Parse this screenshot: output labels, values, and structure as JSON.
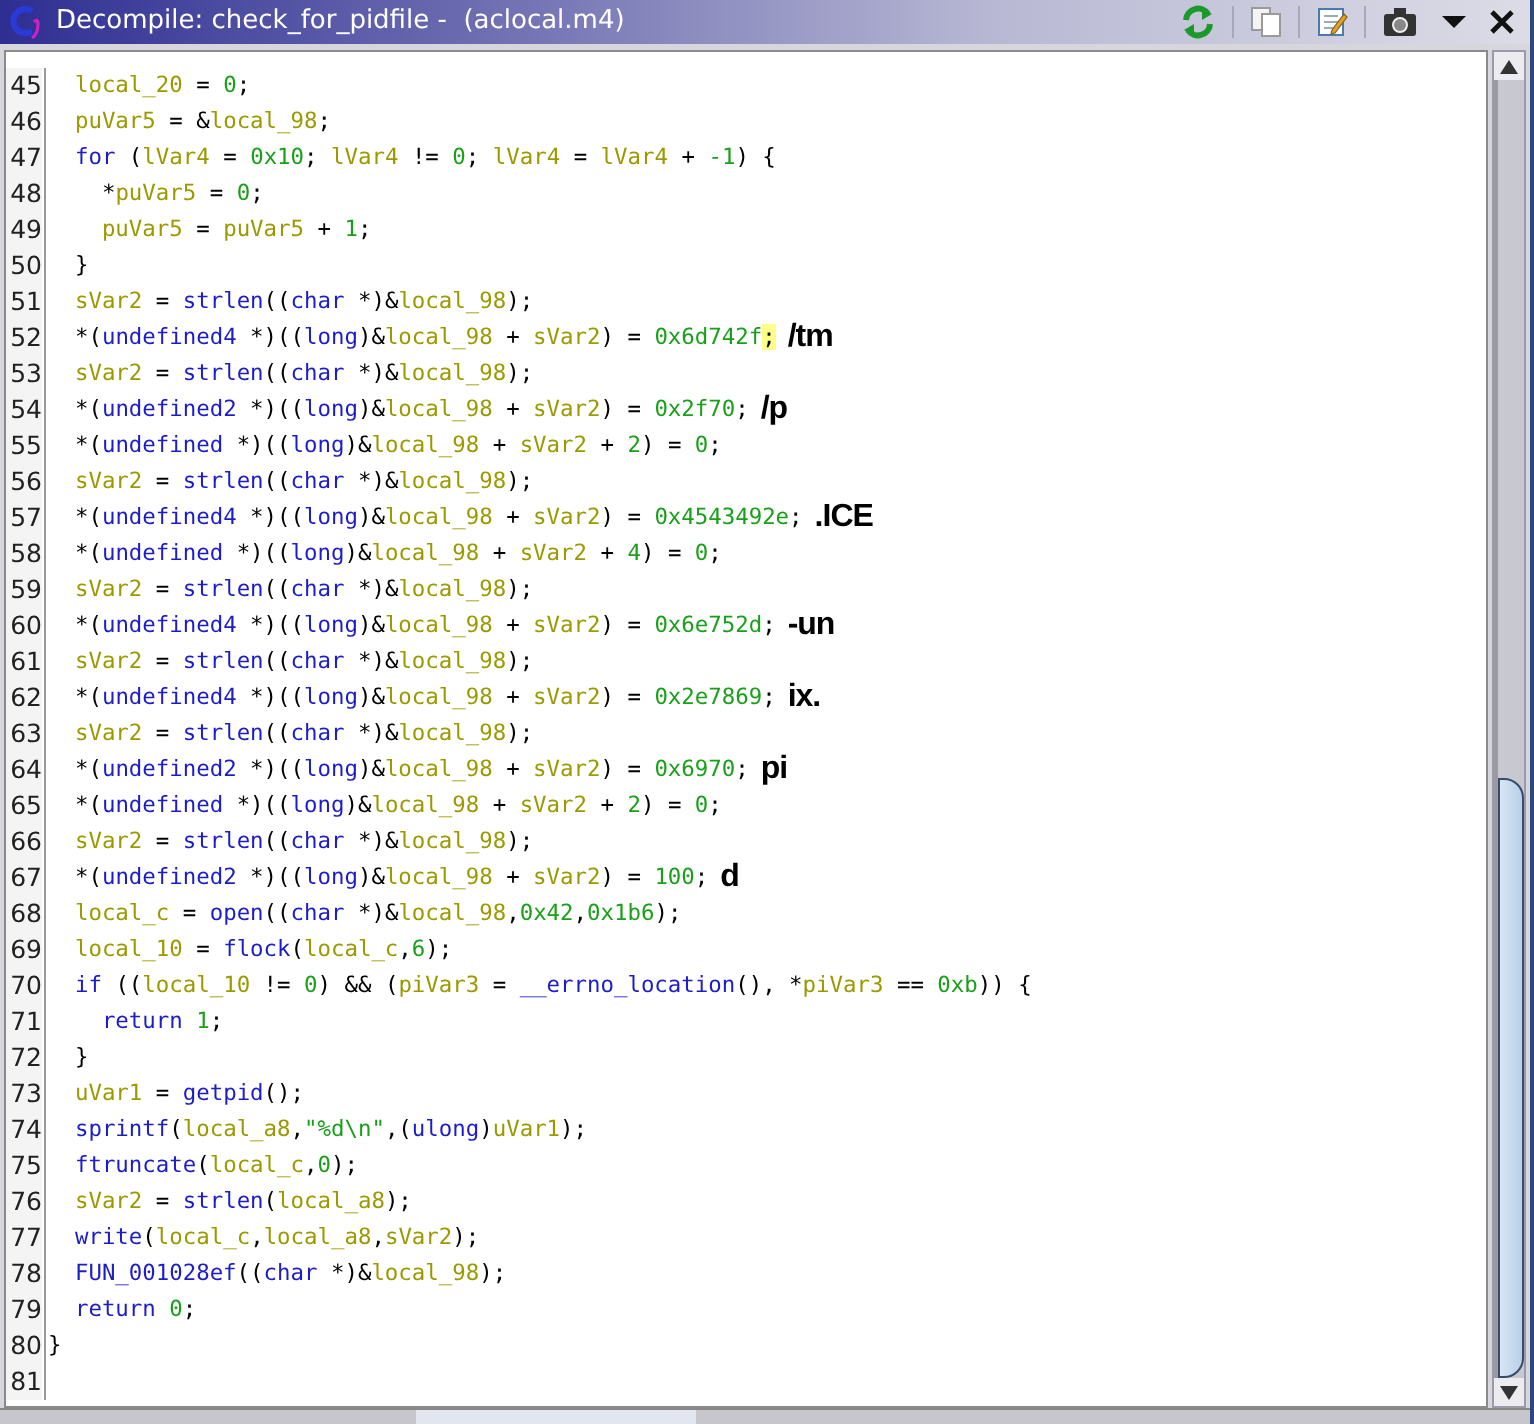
{
  "window": {
    "title": "Decompile: check_for_pidfile -  (aclocal.m4)"
  },
  "code_lines": [
    {
      "number": "45",
      "tokens": [
        {
          "kind": "var",
          "text": "  local_20"
        },
        {
          "kind": "plain",
          "text": " = "
        },
        {
          "kind": "num",
          "text": "0"
        },
        {
          "kind": "plain",
          "text": ";"
        }
      ]
    },
    {
      "number": "46",
      "tokens": [
        {
          "kind": "var",
          "text": "  puVar5"
        },
        {
          "kind": "plain",
          "text": " = &"
        },
        {
          "kind": "var",
          "text": "local_98"
        },
        {
          "kind": "plain",
          "text": ";"
        }
      ]
    },
    {
      "number": "47",
      "tokens": [
        {
          "kind": "kw",
          "text": "  for"
        },
        {
          "kind": "plain",
          "text": " ("
        },
        {
          "kind": "var",
          "text": "lVar4"
        },
        {
          "kind": "plain",
          "text": " = "
        },
        {
          "kind": "num",
          "text": "0x10"
        },
        {
          "kind": "plain",
          "text": "; "
        },
        {
          "kind": "var",
          "text": "lVar4"
        },
        {
          "kind": "plain",
          "text": " != "
        },
        {
          "kind": "num",
          "text": "0"
        },
        {
          "kind": "plain",
          "text": "; "
        },
        {
          "kind": "var",
          "text": "lVar4"
        },
        {
          "kind": "plain",
          "text": " = "
        },
        {
          "kind": "var",
          "text": "lVar4"
        },
        {
          "kind": "plain",
          "text": " + "
        },
        {
          "kind": "num",
          "text": "-1"
        },
        {
          "kind": "plain",
          "text": ") {"
        }
      ]
    },
    {
      "number": "48",
      "tokens": [
        {
          "kind": "plain",
          "text": "    *"
        },
        {
          "kind": "var",
          "text": "puVar5"
        },
        {
          "kind": "plain",
          "text": " = "
        },
        {
          "kind": "num",
          "text": "0"
        },
        {
          "kind": "plain",
          "text": ";"
        }
      ]
    },
    {
      "number": "49",
      "tokens": [
        {
          "kind": "var",
          "text": "    puVar5"
        },
        {
          "kind": "plain",
          "text": " = "
        },
        {
          "kind": "var",
          "text": "puVar5"
        },
        {
          "kind": "plain",
          "text": " + "
        },
        {
          "kind": "num",
          "text": "1"
        },
        {
          "kind": "plain",
          "text": ";"
        }
      ]
    },
    {
      "number": "50",
      "tokens": [
        {
          "kind": "plain",
          "text": "  }"
        }
      ]
    },
    {
      "number": "51",
      "tokens": [
        {
          "kind": "var",
          "text": "  sVar2"
        },
        {
          "kind": "plain",
          "text": " = "
        },
        {
          "kind": "fn",
          "text": "strlen"
        },
        {
          "kind": "plain",
          "text": "(("
        },
        {
          "kind": "kw",
          "text": "char"
        },
        {
          "kind": "plain",
          "text": " *)&"
        },
        {
          "kind": "var",
          "text": "local_98"
        },
        {
          "kind": "plain",
          "text": ");"
        }
      ]
    },
    {
      "number": "52",
      "annotation": "/tm",
      "tokens": [
        {
          "kind": "plain",
          "text": "  *("
        },
        {
          "kind": "kw",
          "text": "undefined4"
        },
        {
          "kind": "plain",
          "text": " *)(("
        },
        {
          "kind": "kw",
          "text": "long"
        },
        {
          "kind": "plain",
          "text": ")&"
        },
        {
          "kind": "var",
          "text": "local_98"
        },
        {
          "kind": "plain",
          "text": " + "
        },
        {
          "kind": "var",
          "text": "sVar2"
        },
        {
          "kind": "plain",
          "text": ") = "
        },
        {
          "kind": "num",
          "text": "0x6d742f"
        },
        {
          "kind": "highlight",
          "text": ";"
        }
      ]
    },
    {
      "number": "53",
      "tokens": [
        {
          "kind": "var",
          "text": "  sVar2"
        },
        {
          "kind": "plain",
          "text": " = "
        },
        {
          "kind": "fn",
          "text": "strlen"
        },
        {
          "kind": "plain",
          "text": "(("
        },
        {
          "kind": "kw",
          "text": "char"
        },
        {
          "kind": "plain",
          "text": " *)&"
        },
        {
          "kind": "var",
          "text": "local_98"
        },
        {
          "kind": "plain",
          "text": ");"
        }
      ]
    },
    {
      "number": "54",
      "annotation": "/p",
      "tokens": [
        {
          "kind": "plain",
          "text": "  *("
        },
        {
          "kind": "kw",
          "text": "undefined2"
        },
        {
          "kind": "plain",
          "text": " *)(("
        },
        {
          "kind": "kw",
          "text": "long"
        },
        {
          "kind": "plain",
          "text": ")&"
        },
        {
          "kind": "var",
          "text": "local_98"
        },
        {
          "kind": "plain",
          "text": " + "
        },
        {
          "kind": "var",
          "text": "sVar2"
        },
        {
          "kind": "plain",
          "text": ") = "
        },
        {
          "kind": "num",
          "text": "0x2f70"
        },
        {
          "kind": "plain",
          "text": ";"
        }
      ]
    },
    {
      "number": "55",
      "tokens": [
        {
          "kind": "plain",
          "text": "  *("
        },
        {
          "kind": "kw",
          "text": "undefined"
        },
        {
          "kind": "plain",
          "text": " *)(("
        },
        {
          "kind": "kw",
          "text": "long"
        },
        {
          "kind": "plain",
          "text": ")&"
        },
        {
          "kind": "var",
          "text": "local_98"
        },
        {
          "kind": "plain",
          "text": " + "
        },
        {
          "kind": "var",
          "text": "sVar2"
        },
        {
          "kind": "plain",
          "text": " + "
        },
        {
          "kind": "num",
          "text": "2"
        },
        {
          "kind": "plain",
          "text": ") = "
        },
        {
          "kind": "num",
          "text": "0"
        },
        {
          "kind": "plain",
          "text": ";"
        }
      ]
    },
    {
      "number": "56",
      "tokens": [
        {
          "kind": "var",
          "text": "  sVar2"
        },
        {
          "kind": "plain",
          "text": " = "
        },
        {
          "kind": "fn",
          "text": "strlen"
        },
        {
          "kind": "plain",
          "text": "(("
        },
        {
          "kind": "kw",
          "text": "char"
        },
        {
          "kind": "plain",
          "text": " *)&"
        },
        {
          "kind": "var",
          "text": "local_98"
        },
        {
          "kind": "plain",
          "text": ");"
        }
      ]
    },
    {
      "number": "57",
      "annotation": ".ICE",
      "tokens": [
        {
          "kind": "plain",
          "text": "  *("
        },
        {
          "kind": "kw",
          "text": "undefined4"
        },
        {
          "kind": "plain",
          "text": " *)(("
        },
        {
          "kind": "kw",
          "text": "long"
        },
        {
          "kind": "plain",
          "text": ")&"
        },
        {
          "kind": "var",
          "text": "local_98"
        },
        {
          "kind": "plain",
          "text": " + "
        },
        {
          "kind": "var",
          "text": "sVar2"
        },
        {
          "kind": "plain",
          "text": ") = "
        },
        {
          "kind": "num",
          "text": "0x4543492e"
        },
        {
          "kind": "plain",
          "text": ";"
        }
      ]
    },
    {
      "number": "58",
      "tokens": [
        {
          "kind": "plain",
          "text": "  *("
        },
        {
          "kind": "kw",
          "text": "undefined"
        },
        {
          "kind": "plain",
          "text": " *)(("
        },
        {
          "kind": "kw",
          "text": "long"
        },
        {
          "kind": "plain",
          "text": ")&"
        },
        {
          "kind": "var",
          "text": "local_98"
        },
        {
          "kind": "plain",
          "text": " + "
        },
        {
          "kind": "var",
          "text": "sVar2"
        },
        {
          "kind": "plain",
          "text": " + "
        },
        {
          "kind": "num",
          "text": "4"
        },
        {
          "kind": "plain",
          "text": ") = "
        },
        {
          "kind": "num",
          "text": "0"
        },
        {
          "kind": "plain",
          "text": ";"
        }
      ]
    },
    {
      "number": "59",
      "tokens": [
        {
          "kind": "var",
          "text": "  sVar2"
        },
        {
          "kind": "plain",
          "text": " = "
        },
        {
          "kind": "fn",
          "text": "strlen"
        },
        {
          "kind": "plain",
          "text": "(("
        },
        {
          "kind": "kw",
          "text": "char"
        },
        {
          "kind": "plain",
          "text": " *)&"
        },
        {
          "kind": "var",
          "text": "local_98"
        },
        {
          "kind": "plain",
          "text": ");"
        }
      ]
    },
    {
      "number": "60",
      "annotation": "-un",
      "tokens": [
        {
          "kind": "plain",
          "text": "  *("
        },
        {
          "kind": "kw",
          "text": "undefined4"
        },
        {
          "kind": "plain",
          "text": " *)(("
        },
        {
          "kind": "kw",
          "text": "long"
        },
        {
          "kind": "plain",
          "text": ")&"
        },
        {
          "kind": "var",
          "text": "local_98"
        },
        {
          "kind": "plain",
          "text": " + "
        },
        {
          "kind": "var",
          "text": "sVar2"
        },
        {
          "kind": "plain",
          "text": ") = "
        },
        {
          "kind": "num",
          "text": "0x6e752d"
        },
        {
          "kind": "plain",
          "text": ";"
        }
      ]
    },
    {
      "number": "61",
      "tokens": [
        {
          "kind": "var",
          "text": "  sVar2"
        },
        {
          "kind": "plain",
          "text": " = "
        },
        {
          "kind": "fn",
          "text": "strlen"
        },
        {
          "kind": "plain",
          "text": "(("
        },
        {
          "kind": "kw",
          "text": "char"
        },
        {
          "kind": "plain",
          "text": " *)&"
        },
        {
          "kind": "var",
          "text": "local_98"
        },
        {
          "kind": "plain",
          "text": ");"
        }
      ]
    },
    {
      "number": "62",
      "annotation": "ix.",
      "tokens": [
        {
          "kind": "plain",
          "text": "  *("
        },
        {
          "kind": "kw",
          "text": "undefined4"
        },
        {
          "kind": "plain",
          "text": " *)(("
        },
        {
          "kind": "kw",
          "text": "long"
        },
        {
          "kind": "plain",
          "text": ")&"
        },
        {
          "kind": "var",
          "text": "local_98"
        },
        {
          "kind": "plain",
          "text": " + "
        },
        {
          "kind": "var",
          "text": "sVar2"
        },
        {
          "kind": "plain",
          "text": ") = "
        },
        {
          "kind": "num",
          "text": "0x2e7869"
        },
        {
          "kind": "plain",
          "text": ";"
        }
      ]
    },
    {
      "number": "63",
      "tokens": [
        {
          "kind": "var",
          "text": "  sVar2"
        },
        {
          "kind": "plain",
          "text": " = "
        },
        {
          "kind": "fn",
          "text": "strlen"
        },
        {
          "kind": "plain",
          "text": "(("
        },
        {
          "kind": "kw",
          "text": "char"
        },
        {
          "kind": "plain",
          "text": " *)&"
        },
        {
          "kind": "var",
          "text": "local_98"
        },
        {
          "kind": "plain",
          "text": ");"
        }
      ]
    },
    {
      "number": "64",
      "annotation": "pi",
      "tokens": [
        {
          "kind": "plain",
          "text": "  *("
        },
        {
          "kind": "kw",
          "text": "undefined2"
        },
        {
          "kind": "plain",
          "text": " *)(("
        },
        {
          "kind": "kw",
          "text": "long"
        },
        {
          "kind": "plain",
          "text": ")&"
        },
        {
          "kind": "var",
          "text": "local_98"
        },
        {
          "kind": "plain",
          "text": " + "
        },
        {
          "kind": "var",
          "text": "sVar2"
        },
        {
          "kind": "plain",
          "text": ") = "
        },
        {
          "kind": "num",
          "text": "0x6970"
        },
        {
          "kind": "plain",
          "text": ";"
        }
      ]
    },
    {
      "number": "65",
      "tokens": [
        {
          "kind": "plain",
          "text": "  *("
        },
        {
          "kind": "kw",
          "text": "undefined"
        },
        {
          "kind": "plain",
          "text": " *)(("
        },
        {
          "kind": "kw",
          "text": "long"
        },
        {
          "kind": "plain",
          "text": ")&"
        },
        {
          "kind": "var",
          "text": "local_98"
        },
        {
          "kind": "plain",
          "text": " + "
        },
        {
          "kind": "var",
          "text": "sVar2"
        },
        {
          "kind": "plain",
          "text": " + "
        },
        {
          "kind": "num",
          "text": "2"
        },
        {
          "kind": "plain",
          "text": ") = "
        },
        {
          "kind": "num",
          "text": "0"
        },
        {
          "kind": "plain",
          "text": ";"
        }
      ]
    },
    {
      "number": "66",
      "tokens": [
        {
          "kind": "var",
          "text": "  sVar2"
        },
        {
          "kind": "plain",
          "text": " = "
        },
        {
          "kind": "fn",
          "text": "strlen"
        },
        {
          "kind": "plain",
          "text": "(("
        },
        {
          "kind": "kw",
          "text": "char"
        },
        {
          "kind": "plain",
          "text": " *)&"
        },
        {
          "kind": "var",
          "text": "local_98"
        },
        {
          "kind": "plain",
          "text": ");"
        }
      ]
    },
    {
      "number": "67",
      "annotation": "d",
      "tokens": [
        {
          "kind": "plain",
          "text": "  *("
        },
        {
          "kind": "kw",
          "text": "undefined2"
        },
        {
          "kind": "plain",
          "text": " *)(("
        },
        {
          "kind": "kw",
          "text": "long"
        },
        {
          "kind": "plain",
          "text": ")&"
        },
        {
          "kind": "var",
          "text": "local_98"
        },
        {
          "kind": "plain",
          "text": " + "
        },
        {
          "kind": "var",
          "text": "sVar2"
        },
        {
          "kind": "plain",
          "text": ") = "
        },
        {
          "kind": "num",
          "text": "100"
        },
        {
          "kind": "plain",
          "text": ";"
        }
      ]
    },
    {
      "number": "68",
      "tokens": [
        {
          "kind": "var",
          "text": "  local_c"
        },
        {
          "kind": "plain",
          "text": " = "
        },
        {
          "kind": "fn",
          "text": "open"
        },
        {
          "kind": "plain",
          "text": "(("
        },
        {
          "kind": "kw",
          "text": "char"
        },
        {
          "kind": "plain",
          "text": " *)&"
        },
        {
          "kind": "var",
          "text": "local_98"
        },
        {
          "kind": "plain",
          "text": ","
        },
        {
          "kind": "num",
          "text": "0x42"
        },
        {
          "kind": "plain",
          "text": ","
        },
        {
          "kind": "num",
          "text": "0x1b6"
        },
        {
          "kind": "plain",
          "text": ");"
        }
      ]
    },
    {
      "number": "69",
      "tokens": [
        {
          "kind": "var",
          "text": "  local_10"
        },
        {
          "kind": "plain",
          "text": " = "
        },
        {
          "kind": "fn",
          "text": "flock"
        },
        {
          "kind": "plain",
          "text": "("
        },
        {
          "kind": "var",
          "text": "local_c"
        },
        {
          "kind": "plain",
          "text": ","
        },
        {
          "kind": "num",
          "text": "6"
        },
        {
          "kind": "plain",
          "text": ");"
        }
      ]
    },
    {
      "number": "70",
      "tokens": [
        {
          "kind": "kw",
          "text": "  if"
        },
        {
          "kind": "plain",
          "text": " (("
        },
        {
          "kind": "var",
          "text": "local_10"
        },
        {
          "kind": "plain",
          "text": " != "
        },
        {
          "kind": "num",
          "text": "0"
        },
        {
          "kind": "plain",
          "text": ") && ("
        },
        {
          "kind": "var",
          "text": "piVar3"
        },
        {
          "kind": "plain",
          "text": " = "
        },
        {
          "kind": "fn",
          "text": "__errno_location"
        },
        {
          "kind": "plain",
          "text": "(), *"
        },
        {
          "kind": "var",
          "text": "piVar3"
        },
        {
          "kind": "plain",
          "text": " == "
        },
        {
          "kind": "num",
          "text": "0xb"
        },
        {
          "kind": "plain",
          "text": ")) {"
        }
      ]
    },
    {
      "number": "71",
      "tokens": [
        {
          "kind": "kw",
          "text": "    return"
        },
        {
          "kind": "num",
          "text": " 1"
        },
        {
          "kind": "plain",
          "text": ";"
        }
      ]
    },
    {
      "number": "72",
      "tokens": [
        {
          "kind": "plain",
          "text": "  }"
        }
      ]
    },
    {
      "number": "73",
      "tokens": [
        {
          "kind": "var",
          "text": "  uVar1"
        },
        {
          "kind": "plain",
          "text": " = "
        },
        {
          "kind": "fn",
          "text": "getpid"
        },
        {
          "kind": "plain",
          "text": "();"
        }
      ]
    },
    {
      "number": "74",
      "tokens": [
        {
          "kind": "fn",
          "text": "  sprintf"
        },
        {
          "kind": "plain",
          "text": "("
        },
        {
          "kind": "var",
          "text": "local_a8"
        },
        {
          "kind": "plain",
          "text": ","
        },
        {
          "kind": "str",
          "text": "\"%d\\n\""
        },
        {
          "kind": "plain",
          "text": ",("
        },
        {
          "kind": "kw",
          "text": "ulong"
        },
        {
          "kind": "plain",
          "text": ")"
        },
        {
          "kind": "var",
          "text": "uVar1"
        },
        {
          "kind": "plain",
          "text": ");"
        }
      ]
    },
    {
      "number": "75",
      "tokens": [
        {
          "kind": "fn",
          "text": "  ftruncate"
        },
        {
          "kind": "plain",
          "text": "("
        },
        {
          "kind": "var",
          "text": "local_c"
        },
        {
          "kind": "plain",
          "text": ","
        },
        {
          "kind": "num",
          "text": "0"
        },
        {
          "kind": "plain",
          "text": ");"
        }
      ]
    },
    {
      "number": "76",
      "tokens": [
        {
          "kind": "var",
          "text": "  sVar2"
        },
        {
          "kind": "plain",
          "text": " = "
        },
        {
          "kind": "fn",
          "text": "strlen"
        },
        {
          "kind": "plain",
          "text": "("
        },
        {
          "kind": "var",
          "text": "local_a8"
        },
        {
          "kind": "plain",
          "text": ");"
        }
      ]
    },
    {
      "number": "77",
      "tokens": [
        {
          "kind": "fn",
          "text": "  write"
        },
        {
          "kind": "plain",
          "text": "("
        },
        {
          "kind": "var",
          "text": "local_c"
        },
        {
          "kind": "plain",
          "text": ","
        },
        {
          "kind": "var",
          "text": "local_a8"
        },
        {
          "kind": "plain",
          "text": ","
        },
        {
          "kind": "var",
          "text": "sVar2"
        },
        {
          "kind": "plain",
          "text": ");"
        }
      ]
    },
    {
      "number": "78",
      "tokens": [
        {
          "kind": "fn",
          "text": "  FUN_001028ef"
        },
        {
          "kind": "plain",
          "text": "(("
        },
        {
          "kind": "kw",
          "text": "char"
        },
        {
          "kind": "plain",
          "text": " *)&"
        },
        {
          "kind": "var",
          "text": "local_98"
        },
        {
          "kind": "plain",
          "text": ");"
        }
      ]
    },
    {
      "number": "79",
      "tokens": [
        {
          "kind": "kw",
          "text": "  return"
        },
        {
          "kind": "num",
          "text": " 0"
        },
        {
          "kind": "plain",
          "text": ";"
        }
      ]
    },
    {
      "number": "80",
      "tokens": [
        {
          "kind": "plain",
          "text": "}"
        }
      ]
    },
    {
      "number": "81"
    }
  ]
}
